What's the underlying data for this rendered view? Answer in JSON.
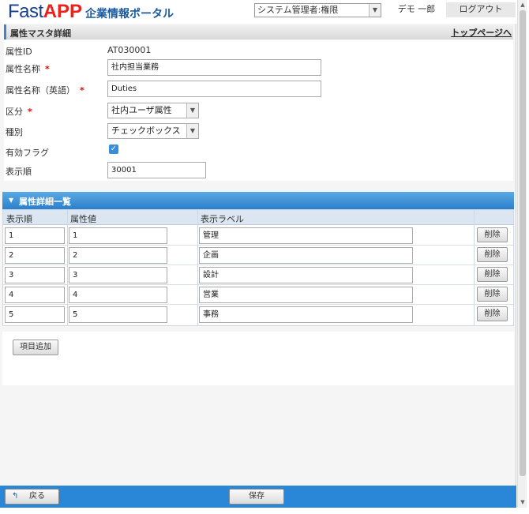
{
  "header": {
    "logo_fast": "Fast",
    "logo_app": "APP",
    "logo_sub": "企業情報ポータル",
    "role_select": "システム管理者:権限",
    "user": "デモ 一郎",
    "logout": "ログアウト"
  },
  "titlebar": {
    "title": "属性マスタ詳細",
    "top_link": "トップページへ"
  },
  "form": {
    "attr_id_label": "属性ID",
    "attr_id_value": "AT030001",
    "attr_name_label": "属性名称",
    "attr_name_value": "社内担当業務",
    "attr_name_en_label": "属性名称（英語）",
    "attr_name_en_value": "Duties",
    "category_label": "区分",
    "category_value": "社内ユーザ属性",
    "type_label": "種別",
    "type_value": "チェックボックス",
    "enabled_label": "有効フラグ",
    "enabled_checked": true,
    "order_label": "表示順",
    "order_value": "30001",
    "required_mark": "*"
  },
  "detail": {
    "title": "属性詳細一覧",
    "columns": [
      "表示順",
      "属性値",
      "表示ラベル"
    ],
    "rows": [
      {
        "order": "1",
        "value": "1",
        "label": "管理"
      },
      {
        "order": "2",
        "value": "2",
        "label": "企画"
      },
      {
        "order": "3",
        "value": "3",
        "label": "設計"
      },
      {
        "order": "4",
        "value": "4",
        "label": "営業"
      },
      {
        "order": "5",
        "value": "5",
        "label": "事務"
      }
    ],
    "delete_label": "削除",
    "add_label": "項目追加"
  },
  "footer": {
    "back_label": "戻る",
    "save_label": "保存"
  },
  "colors": {
    "accent": "#2a86d6",
    "logo_blue": "#1a3f8c",
    "logo_red": "#e8231c",
    "required": "#ee0000"
  }
}
